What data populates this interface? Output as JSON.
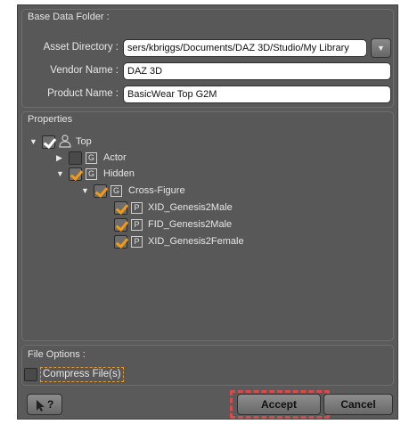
{
  "base_folder": {
    "title": "Base Data Folder :",
    "asset_directory_label": "Asset Directory :",
    "asset_directory_value": "sers/kbriggs/Documents/DAZ 3D/Studio/My Library",
    "vendor_name_label": "Vendor Name :",
    "vendor_name_value": "DAZ 3D",
    "product_name_label": "Product Name :",
    "product_name_value": "BasicWear Top G2M"
  },
  "properties": {
    "title": "Properties",
    "tree": [
      {
        "label": "Top",
        "icon": "figure-icon",
        "checked": true
      },
      {
        "label": "Actor",
        "icon": "group-icon",
        "icon_glyph": "G",
        "checked": false
      },
      {
        "label": "Hidden",
        "icon": "group-icon",
        "icon_glyph": "G",
        "checked": true
      },
      {
        "label": "Cross-Figure",
        "icon": "group-icon",
        "icon_glyph": "G",
        "checked": true
      },
      {
        "label": "XID_Genesis2Male",
        "icon": "property-icon",
        "icon_glyph": "P",
        "checked": true
      },
      {
        "label": "FID_Genesis2Male",
        "icon": "property-icon",
        "icon_glyph": "P",
        "checked": true
      },
      {
        "label": "XID_Genesis2Female",
        "icon": "property-icon",
        "icon_glyph": "P",
        "checked": true
      }
    ]
  },
  "file_options": {
    "title": "File Options :",
    "compress_label": "Compress File(s)",
    "compress_checked": false
  },
  "buttons": {
    "help": "?",
    "accept": "Accept",
    "cancel": "Cancel"
  },
  "colors": {
    "accent_check": "#f39a12",
    "highlight_dashed": "#d94a4a",
    "dialog_bg": "#5a5a5a"
  }
}
